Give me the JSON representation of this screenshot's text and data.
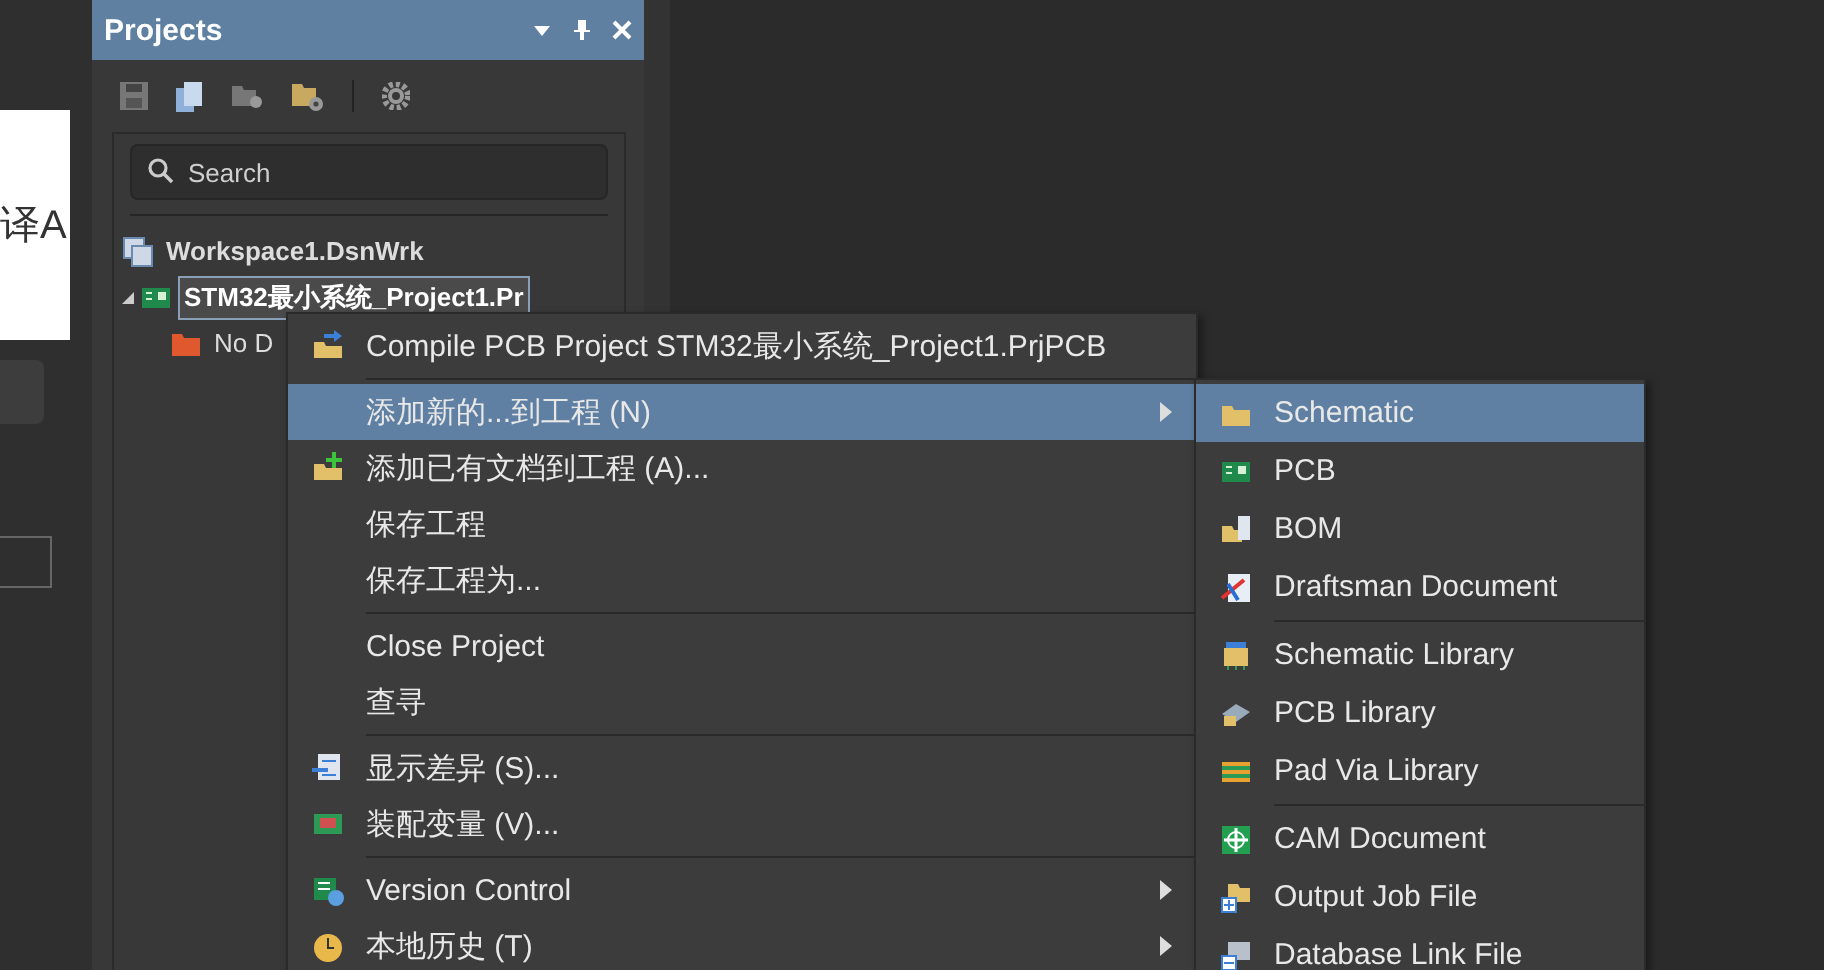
{
  "left_pane": {
    "card_text": "译A"
  },
  "projects_panel": {
    "title": "Projects",
    "search": {
      "placeholder": "Search"
    },
    "tree": [
      {
        "label": "Workspace1.DsnWrk",
        "kind": "workspace",
        "selected": false,
        "children": [
          {
            "label": "STM32最小系统_Project1.Pr",
            "kind": "project",
            "selected": true,
            "expanded": true,
            "children": [
              {
                "label": "No D",
                "kind": "folder",
                "selected": false
              }
            ]
          }
        ]
      }
    ]
  },
  "context_menu": {
    "items": [
      {
        "kind": "item",
        "label": "Compile PCB Project STM32最小系统_Project1.PrjPCB",
        "selected": false,
        "submenu": false
      },
      {
        "kind": "separator"
      },
      {
        "kind": "item",
        "label": "添加新的...到工程 (N)",
        "selected": true,
        "submenu": true
      },
      {
        "kind": "item",
        "label": "添加已有文档到工程 (A)...",
        "selected": false,
        "submenu": false
      },
      {
        "kind": "item",
        "label": "保存工程",
        "selected": false,
        "submenu": false
      },
      {
        "kind": "item",
        "label": "保存工程为...",
        "selected": false,
        "submenu": false
      },
      {
        "kind": "separator"
      },
      {
        "kind": "item",
        "label": "Close Project",
        "selected": false,
        "submenu": false
      },
      {
        "kind": "item",
        "label": "查寻",
        "selected": false,
        "submenu": false
      },
      {
        "kind": "separator"
      },
      {
        "kind": "item",
        "label": "显示差异 (S)...",
        "selected": false,
        "submenu": false
      },
      {
        "kind": "item",
        "label": "装配变量 (V)...",
        "selected": false,
        "submenu": false
      },
      {
        "kind": "separator"
      },
      {
        "kind": "item",
        "label": "Version Control",
        "selected": false,
        "submenu": true
      },
      {
        "kind": "item",
        "label": "本地历史 (T)",
        "selected": false,
        "submenu": true
      }
    ]
  },
  "submenu": {
    "items": [
      {
        "kind": "item",
        "label": "Schematic",
        "selected": true
      },
      {
        "kind": "item",
        "label": "PCB",
        "selected": false
      },
      {
        "kind": "item",
        "label": "BOM",
        "selected": false
      },
      {
        "kind": "item",
        "label": "Draftsman Document",
        "selected": false
      },
      {
        "kind": "separator"
      },
      {
        "kind": "item",
        "label": "Schematic Library",
        "selected": false
      },
      {
        "kind": "item",
        "label": "PCB Library",
        "selected": false
      },
      {
        "kind": "item",
        "label": "Pad Via Library",
        "selected": false
      },
      {
        "kind": "separator"
      },
      {
        "kind": "item",
        "label": "CAM Document",
        "selected": false
      },
      {
        "kind": "item",
        "label": "Output Job File",
        "selected": false
      },
      {
        "kind": "item",
        "label": "Database Link File",
        "selected": false
      }
    ]
  }
}
